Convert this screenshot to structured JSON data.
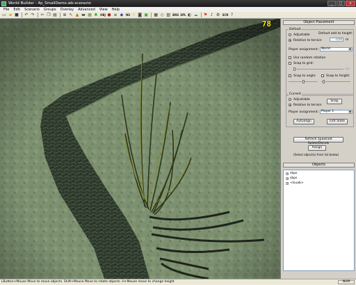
{
  "window": {
    "title": "World Builder - 4p_SmallDemo.wb-scenario",
    "minimize": "_",
    "maximize": "□",
    "close": "x"
  },
  "menubar": [
    "File",
    "Edit",
    "Scenario",
    "Groups",
    "Overlay",
    "Advanced",
    "View",
    "Help"
  ],
  "toolbar": {
    "icons": [
      "new-icon",
      "open-icon",
      "save-icon",
      "undo-icon",
      "redo-icon",
      "cut-icon",
      "copy-icon",
      "paste-icon",
      "select-icon",
      "zoom-icon",
      "pointer-icon",
      "height-icon",
      "flatten-icon",
      "texture-icon",
      "blend-icon",
      "tree-icon",
      "object-icon",
      "waypoint-icon",
      "road-icon",
      "water-icon",
      "light-icon",
      "camera-icon",
      "sound-icon",
      "area-icon",
      "team-icon",
      "grid-icon",
      "wire-icon",
      "fog-icon",
      "shadow-icon",
      "sky-icon",
      "props-icon",
      "help-icon"
    ],
    "labels": {
      "obj": "OBJ",
      "ns": "NS",
      "brs": "BRS",
      "spl": "SPL",
      "scr": "SCR"
    }
  },
  "viewport": {
    "fps": "78"
  },
  "panel": {
    "title": "Object Placement",
    "default_group": {
      "label": "Default",
      "adjustable": "Adjustable",
      "relative": "Relative to terrain",
      "add_height_label": "Default add to height:",
      "add_height_value": "0.00",
      "add_height_unit": "m",
      "player_label": "Player assignment:",
      "player_value": "World",
      "random_rotation": "Use random rotation",
      "snap_grid": "Snap to grid:",
      "snap_angle": "Snap to angle:",
      "snap_height": "Snap to height:",
      "grid_max": "100"
    },
    "current_group": {
      "label": "Current",
      "adjustable": "Adjustable",
      "relative": "Relative to terrain",
      "snap_button": "Snap",
      "player_label": "Player assignment:",
      "player_value": "Player 1",
      "autoalign_button": "Autoalign",
      "edit_state_button": "Edit State"
    },
    "refresh_button": "Refresh Spawned Splats/Decals",
    "assign_button": "Assign",
    "assign_hint": "(Select object(s) from list below)",
    "objects_title": "Objects",
    "tree": [
      "sbps",
      "sbps",
      "<lsuab>"
    ]
  },
  "statusbar": {
    "text": "LButton+Mouse Move to move objects. Shift+Mouse Move to rotate objects. H+Mouse move to change height",
    "num": "NUM"
  },
  "colors": {
    "fps": "#ffea00",
    "terrain": "#7a8f6c",
    "cliff": "#2f3a2c"
  }
}
